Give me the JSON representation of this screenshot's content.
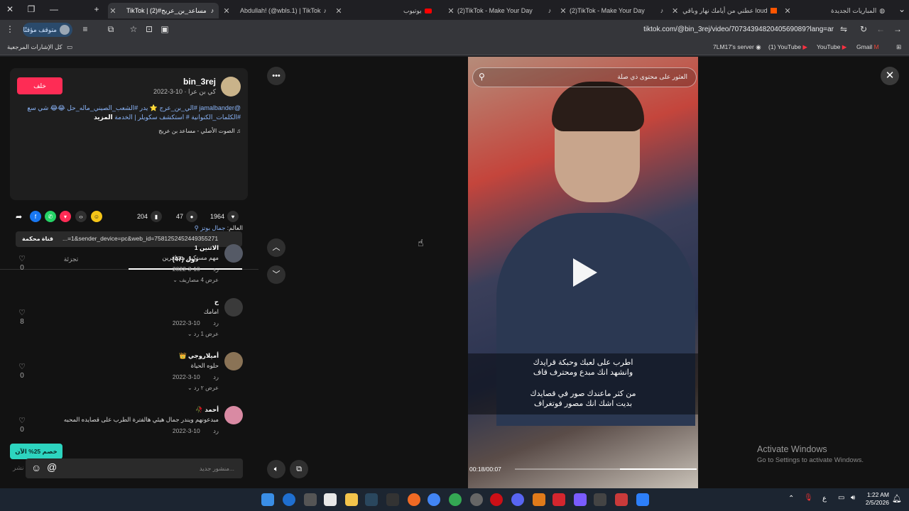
{
  "tabs": [
    {
      "title": "المباريات الجديدة",
      "active": false
    },
    {
      "title": "عطني من أيامك نهار وباقي loud",
      "active": false
    },
    {
      "title": "(2)TikTok - Make Your Day",
      "active": false
    },
    {
      "title": "(2)TikTok - Make Your Day",
      "active": false
    },
    {
      "title": "يوتيوب",
      "active": false
    },
    {
      "title": "Abdullah! (@wbls.1) | TikTok",
      "active": false
    },
    {
      "title": "TikTok | مساعد_بن_عريج#(2)",
      "active": true
    }
  ],
  "toolbar": {
    "paused_label": "متوقف مؤقتًا",
    "url": "tiktok.com/@bin_3rej/video/7073439482040569089?lang=ar"
  },
  "bookmarks": {
    "all_label": "كل الإشارات المرجعية",
    "items": [
      "7LM17's server",
      "(1) YouTube",
      "YouTube",
      "Gmail"
    ]
  },
  "post": {
    "follow_label": "خلف",
    "author": "bin_3rej",
    "author_sub": "كي بن عرا · 10-3-2022",
    "caption": "@jamalbander #الي_بن_عرج ⭐ يدر #الشعب_الصيني_ماله_حل 😂😂 شي سع #الكلمات_الكنوانية # استكشف سكويلر | الخدمة",
    "more_label": "المزيد",
    "music": "الصوت الأصلي - مساعد بن عريج",
    "likes": "1964",
    "comments": "47",
    "saves": "204",
    "link": "...=1&sender_device=pc&web_id=7581252452449355271",
    "copy_label": "قناة محكمة",
    "tab_comments": "(47) دول",
    "tab_creator": "تجزئة",
    "pinned_prefix": "العالم:",
    "pinned_user": "جمال بوتز"
  },
  "comments": [
    {
      "name": "الاثنين 1",
      "text": "مهم مستكين مسافرين",
      "date": "10-3-2022",
      "reply": "رد",
      "replies": "عرض 4 مصاريف",
      "likes": "0"
    },
    {
      "name": "ح",
      "text": "امامك",
      "date": "10-3-2022",
      "reply": "رد",
      "replies": "عرض 1 رد",
      "likes": "8"
    },
    {
      "name": "أميلاروجي 👑",
      "text": "حلوه الحياة",
      "date": "10-3-2022",
      "reply": "رد",
      "replies": "عرض ٢ رد",
      "likes": "0"
    },
    {
      "name": "أحمد 🥀",
      "text": "مبدعونهم ويندر جمال هيئي هالفترة الطرب على قصايده المحبه",
      "date": "10-3-2022",
      "reply": "رد",
      "replies": "",
      "likes": "0"
    }
  ],
  "discount_label": "خصم 25% الآن",
  "comment_input": {
    "placeholder": "منشور جديد...",
    "send": "نشر"
  },
  "video": {
    "search_placeholder": "العثور على محتوى ذي صلة",
    "subtitle_1": "اطرب على لعبك وحبكة قرايدك",
    "subtitle_2": "وانشهد انك مبدع ومحترف قاف",
    "subtitle_3": "من كثر ماعندك صور في قصايدك",
    "subtitle_4": "بديت اشك انك مصور فوتغراف",
    "timecode": "00:18/00:07",
    "progress_fraction": 0.42
  },
  "activate": {
    "title": "Activate Windows",
    "subtitle": "Go to Settings to activate Windows."
  },
  "clock": {
    "time": "1:22 AM",
    "date": "2/5/2026"
  },
  "colors": {
    "tiktok_red": "#fe2c55",
    "discount_teal": "#2dd4bf",
    "link_blue": "#8ab4f8"
  }
}
